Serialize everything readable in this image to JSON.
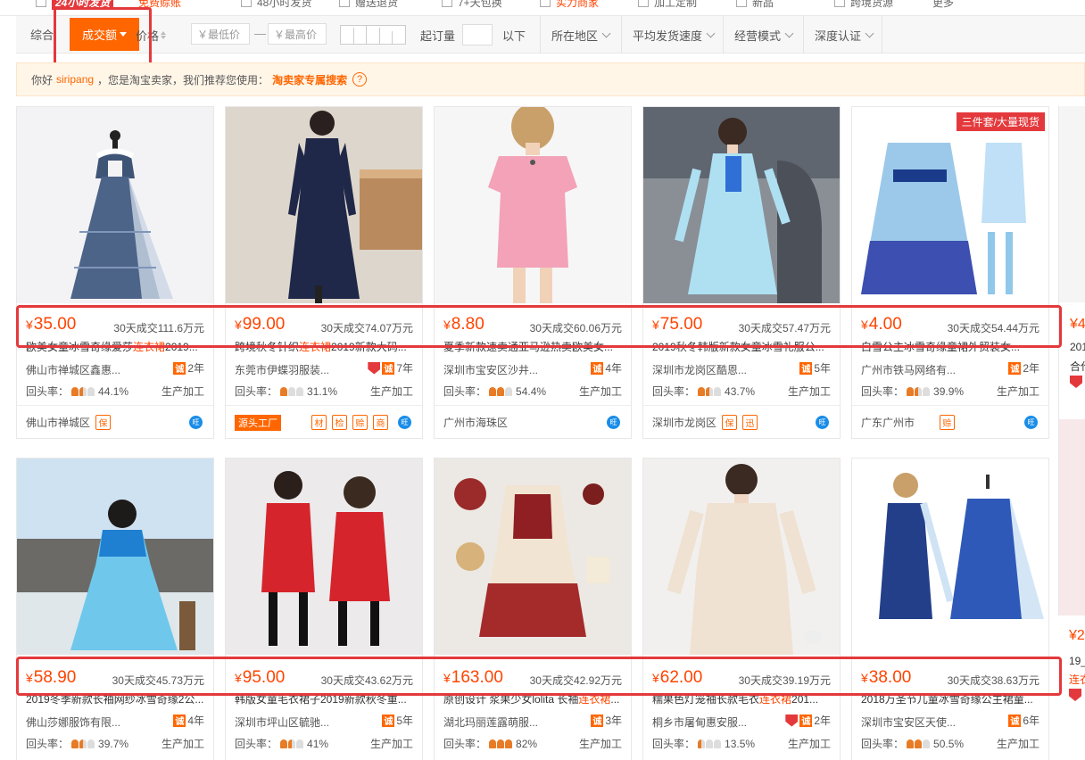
{
  "top_strip": {
    "items": [
      "24小时发货",
      "免费赊账",
      "48小时发货",
      "赠送退货",
      "7+天包换",
      "实力商家",
      "加工定制",
      "新品",
      "跨境货源",
      "更多"
    ]
  },
  "filter_bar": {
    "sort_all": "综合",
    "sort_deal": "成交额",
    "sort_price": "价格",
    "min_price_placeholder": "￥最低价",
    "dash": "—",
    "max_price_placeholder": "￥最高价",
    "moq_label": "起订量",
    "moq_suffix": "以下",
    "location": "所在地区",
    "ship_speed": "平均发货速度",
    "biz_model": "经营模式",
    "depth_cert": "深度认证"
  },
  "notice": {
    "hello": "你好",
    "username": "siripang",
    "text": "，您是淘宝卖家，我们推荐您使用：",
    "link": "淘卖家专属搜索",
    "help": "?"
  },
  "products_row1": [
    {
      "price": "35.00",
      "sold": "30天成交111.6万元",
      "title_a": "欧美女童冰雪奇缘爱莎",
      "title_hl": "连衣裙",
      "title_b": "2019...",
      "company": "佛山市禅城区鑫惠...",
      "years": "2年",
      "repeat": "44.1%",
      "mfg": "生产加工",
      "footer": "佛山市禅城区",
      "icons": [
        "保"
      ],
      "shield": false,
      "source": ""
    },
    {
      "price": "99.00",
      "sold": "30天成交74.07万元",
      "title_a": "跨境秋冬针织",
      "title_hl": "连衣裙",
      "title_b": "2019新款大码...",
      "company": "东莞市伊蝶羽服装...",
      "years": "7年",
      "repeat": "31.1%",
      "mfg": "生产加工",
      "footer": "",
      "icons": [
        "材",
        "检",
        "赊",
        "商"
      ],
      "shield": true,
      "source": "源头工厂"
    },
    {
      "price": "8.80",
      "sold": "30天成交60.06万元",
      "title_a": "夏季新款速卖通亚马逊热卖欧美女...",
      "title_hl": "",
      "title_b": "",
      "company": "深圳市宝安区沙井...",
      "years": "4年",
      "repeat": "54.4%",
      "mfg": "生产加工",
      "footer": "广州市海珠区",
      "icons": [],
      "shield": false,
      "source": ""
    },
    {
      "price": "75.00",
      "sold": "30天成交57.47万元",
      "title_a": "2019秋冬韩版新款女童冰雪礼服公...",
      "title_hl": "",
      "title_b": "",
      "company": "深圳市龙岗区酷恩...",
      "years": "5年",
      "repeat": "43.7%",
      "mfg": "生产加工",
      "footer": "深圳市龙岗区",
      "icons": [
        "保",
        "迅"
      ],
      "shield": false,
      "source": ""
    },
    {
      "price": "4.00",
      "sold": "30天成交54.44万元",
      "title_a": "白雪公主冰雪奇缘童裙外贸装女...",
      "title_hl": "",
      "title_b": "",
      "company": "广州市铁马网络有...",
      "years": "2年",
      "repeat": "39.9%",
      "mfg": "生产加工",
      "footer": "广东广州市",
      "icons": [
        "赊"
      ],
      "shield": false,
      "source": "",
      "promo": "三件套/大量现货"
    }
  ],
  "products_row2": [
    {
      "price": "58.90",
      "sold": "30天成交45.73万元",
      "title_a": "2019冬季新款长袖网纱冰雪奇缘2公...",
      "title_hl": "",
      "title_b": "",
      "company": "佛山莎娜服饰有限...",
      "years": "4年",
      "repeat": "39.7%",
      "mfg": "生产加工",
      "shield": false
    },
    {
      "price": "95.00",
      "sold": "30天成交43.62万元",
      "title_a": "韩版女童毛衣裙子2019新款秋冬重...",
      "title_hl": "",
      "title_b": "",
      "company": "深圳市坪山区毓驰...",
      "years": "5年",
      "repeat": "41%",
      "mfg": "生产加工",
      "shield": false
    },
    {
      "price": "163.00",
      "sold": "30天成交42.92万元",
      "title_a": "原创设计 浆果少女lolita 长袖",
      "title_hl": "连衣裙",
      "title_b": "...",
      "company": "湖北玛丽莲露萌服...",
      "years": "3年",
      "repeat": "82%",
      "mfg": "生产加工",
      "shield": false
    },
    {
      "price": "62.00",
      "sold": "30天成交39.19万元",
      "title_a": "糯果色灯笼袖长款毛衣",
      "title_hl": "连衣裙",
      "title_b": "201...",
      "company": "桐乡市屠甸惠安服...",
      "years": "2年",
      "repeat": "13.5%",
      "mfg": "生产加工",
      "shield": true
    },
    {
      "price": "38.00",
      "sold": "30天成交38.63万元",
      "title_a": "2018万圣节儿童冰雪奇缘公主裙童...",
      "title_hl": "",
      "title_b": "",
      "company": "深圳市宝安区天使...",
      "years": "6年",
      "repeat": "50.5%",
      "mfg": "生产加工",
      "shield": false
    }
  ],
  "partial_col": {
    "row1_price": "¥4",
    "row1_line1": "201",
    "row1_line2": "合代",
    "row2_price": "¥2",
    "row2_line1": "19_",
    "row2_line2": "连衣"
  },
  "labels": {
    "currency": "¥",
    "repeat_label": "回头率：",
    "cheng": "诚",
    "ww": "旺"
  },
  "colors": {
    "accent": "#ff6600",
    "price": "#ff4400",
    "annotation": "#e4393c"
  }
}
